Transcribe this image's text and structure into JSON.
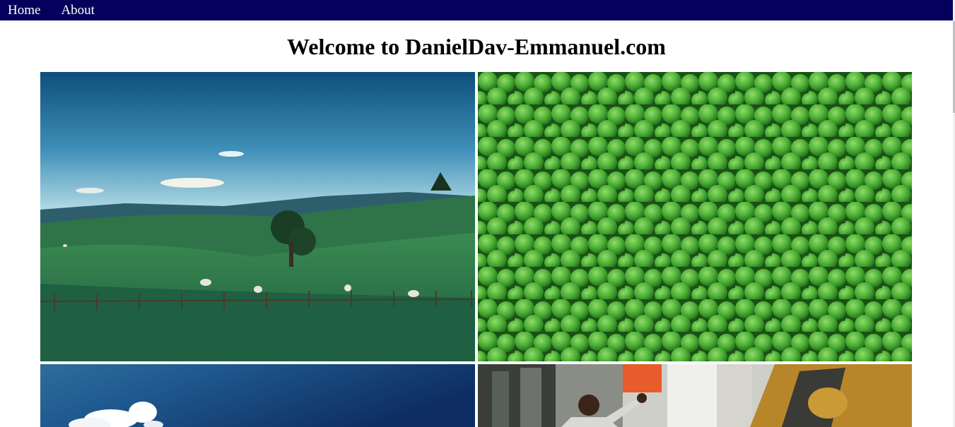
{
  "nav": {
    "items": [
      {
        "label": "Home"
      },
      {
        "label": "About"
      }
    ]
  },
  "page": {
    "title": "Welcome to DanielDav-Emmanuel.com"
  },
  "gallery": {
    "images": [
      {
        "subject": "green pasture landscape with sheep and fence"
      },
      {
        "subject": "close-up of green peas"
      },
      {
        "subject": "blue sky with clouds"
      },
      {
        "subject": "man waving on city street with taxi"
      }
    ]
  },
  "colors": {
    "navbar": "#05005c",
    "nav_text": "#ffffff",
    "title_text": "#000000"
  }
}
